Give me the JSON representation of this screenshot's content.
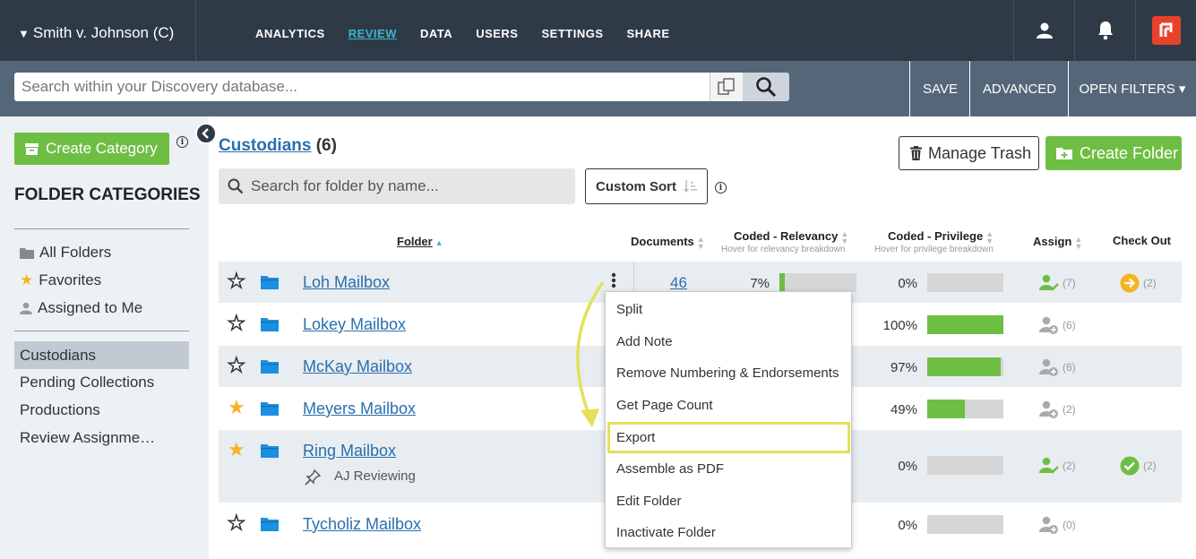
{
  "topbar": {
    "case_title": "Smith v. Johnson (C)",
    "nav": [
      "ANALYTICS",
      "REVIEW",
      "DATA",
      "USERS",
      "SETTINGS",
      "SHARE"
    ],
    "active_nav": "REVIEW"
  },
  "searchbar": {
    "placeholder": "Search within your Discovery database...",
    "save": "SAVE",
    "advanced": "ADVANCED",
    "open_filters": "OPEN FILTERS ▾"
  },
  "sidebar": {
    "create_category": "Create Category",
    "heading": "FOLDER CATEGORIES",
    "group1": [
      "All Folders",
      "Favorites",
      "Assigned to Me"
    ],
    "group2": [
      "Custodians",
      "Pending Collections",
      "Productions",
      "Review Assignme…"
    ],
    "active": "Custodians"
  },
  "main": {
    "title": "Custodians",
    "count": "(6)",
    "folder_search_placeholder": "Search for folder by name...",
    "custom_sort": "Custom Sort",
    "manage_trash": "Manage Trash",
    "create_folder": "Create Folder",
    "columns": {
      "folder": "Folder",
      "documents": "Documents",
      "coded_relevancy": "Coded - Relevancy",
      "coded_relevancy_sub": "Hover for relevancy breakdown",
      "coded_privilege": "Coded - Privilege",
      "coded_privilege_sub": "Hover for privilege breakdown",
      "assign": "Assign",
      "check_out": "Check Out"
    },
    "rows": [
      {
        "name": "Loh Mailbox",
        "favorite": false,
        "documents": "46",
        "relevancy_pct": "7%",
        "relevancy": 0.07,
        "privilege_pct": "0%",
        "privilege": 0,
        "assign": "(7)",
        "assign_active": true,
        "checkout": "(2)",
        "checkout_state": "arrow"
      },
      {
        "name": "Lokey Mailbox",
        "favorite": false,
        "privilege_pct": "100%",
        "privilege": 1.0,
        "assign": "(6)",
        "assign_active": false
      },
      {
        "name": "McKay Mailbox",
        "favorite": false,
        "privilege_pct": "97%",
        "privilege": 0.97,
        "assign": "(6)",
        "assign_active": false
      },
      {
        "name": "Meyers Mailbox",
        "favorite": true,
        "privilege_pct": "49%",
        "privilege": 0.49,
        "assign": "(2)",
        "assign_active": false
      },
      {
        "name": "Ring Mailbox",
        "favorite": true,
        "sub": "AJ Reviewing",
        "privilege_pct": "0%",
        "privilege": 0,
        "assign": "(2)",
        "assign_active": true,
        "checkout": "(2)",
        "checkout_state": "check"
      },
      {
        "name": "Tycholiz Mailbox",
        "favorite": false,
        "privilege_pct": "0%",
        "privilege": 0,
        "assign": "(0)",
        "assign_active": false
      }
    ]
  },
  "context_menu": {
    "items": [
      "Split",
      "Add Note",
      "Remove Numbering & Endorsements",
      "Get Page Count",
      "Export",
      "Assemble as PDF",
      "Edit Folder",
      "Inactivate Folder"
    ],
    "highlighted": "Export"
  },
  "colors": {
    "nav_bg": "#2f3a47",
    "search_bg": "#566679",
    "accent_green": "#6fbe44",
    "link_blue": "#2a6fad",
    "highlight_yellow": "#e3e15a"
  }
}
